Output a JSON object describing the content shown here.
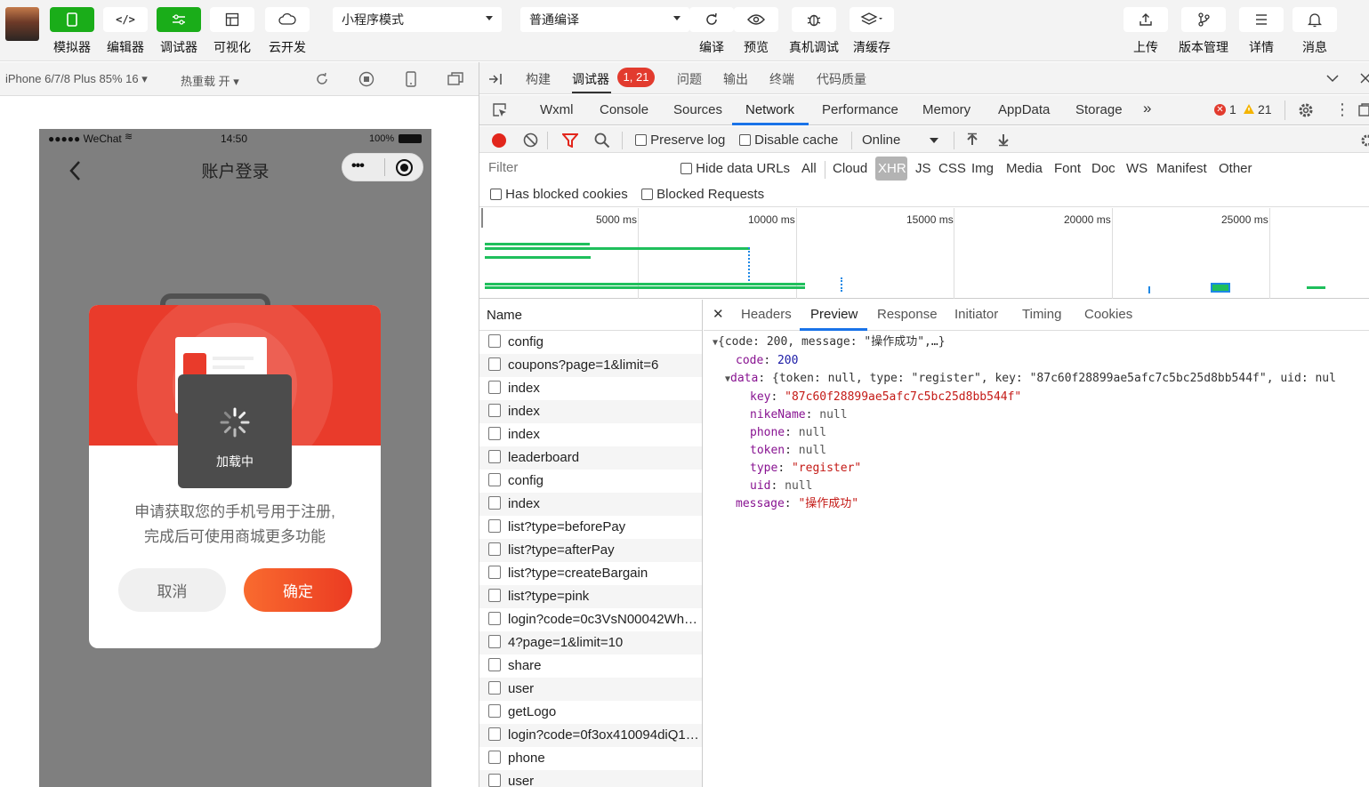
{
  "toolbar": {
    "buttons": [
      {
        "label": "模拟器",
        "icon": "phone-icon"
      },
      {
        "label": "编辑器",
        "icon": "code-icon"
      },
      {
        "label": "调试器",
        "icon": "sliders-icon"
      },
      {
        "label": "可视化",
        "icon": "layout-icon"
      },
      {
        "label": "云开发",
        "icon": "cloud-icon"
      }
    ],
    "mode_select": "小程序模式",
    "compile_select": "普通编译",
    "actions": [
      {
        "label": "编译",
        "icon": "refresh-icon"
      },
      {
        "label": "预览",
        "icon": "eye-icon"
      },
      {
        "label": "真机调试",
        "icon": "bug-icon"
      },
      {
        "label": "清缓存",
        "icon": "layers-icon"
      }
    ],
    "right_actions": [
      {
        "label": "上传",
        "icon": "upload-icon"
      },
      {
        "label": "版本管理",
        "icon": "branch-icon"
      },
      {
        "label": "详情",
        "icon": "menu-icon"
      },
      {
        "label": "消息",
        "icon": "bell-icon"
      }
    ]
  },
  "simulator_bar": {
    "device": "iPhone 6/7/8 Plus 85% 16 ▾",
    "hot_reload": "热重载 开 ▾"
  },
  "phone": {
    "status_left": "●●●●● WeChat",
    "status_time": "14:50",
    "status_battery": "100%",
    "nav_title": "账户登录",
    "dialog_message_line1": "申请获取您的手机号用于注册,",
    "dialog_message_line2": "完成后可使用商城更多功能",
    "cancel_label": "取消",
    "confirm_label": "确定",
    "toast_text": "加载中"
  },
  "devtools": {
    "top_tabs": [
      "构建",
      "调试器",
      "问题",
      "输出",
      "终端",
      "代码质量"
    ],
    "top_badge": "1, 21",
    "panel_tabs": [
      "Wxml",
      "Console",
      "Sources",
      "Network",
      "Performance",
      "Memory",
      "AppData",
      "Storage"
    ],
    "active_panel": "Network",
    "more_tabs": "»",
    "error_count": "1",
    "warning_count": "21",
    "preserve_log": "Preserve log",
    "disable_cache": "Disable cache",
    "throttle": "Online",
    "filter_placeholder": "Filter",
    "hide_data_urls": "Hide data URLs",
    "filter_types": [
      "All",
      "Cloud",
      "XHR",
      "JS",
      "CSS",
      "Img",
      "Media",
      "Font",
      "Doc",
      "WS",
      "Manifest",
      "Other"
    ],
    "active_filter": "XHR",
    "has_blocked_cookies": "Has blocked cookies",
    "blocked_requests": "Blocked Requests",
    "timeline_ticks": [
      "5000 ms",
      "10000 ms",
      "15000 ms",
      "20000 ms",
      "25000 ms"
    ],
    "name_header": "Name",
    "requests": [
      "config",
      "coupons?page=1&limit=6",
      "index",
      "index",
      "index",
      "leaderboard",
      "config",
      "index",
      "list?type=beforePay",
      "list?type=afterPay",
      "list?type=createBargain",
      "list?type=pink",
      "login?code=0c3VsN00042Wh…",
      "4?page=1&limit=10",
      "share",
      "user",
      "getLogo",
      "login?code=0f3ox410094diQ1…",
      "phone",
      "user"
    ],
    "detail_tabs": [
      "Headers",
      "Preview",
      "Response",
      "Initiator",
      "Timing",
      "Cookies"
    ],
    "active_detail_tab": "Preview",
    "close_glyph": "✕",
    "preview": {
      "summary": "{code: 200, message: \"操作成功\",…}",
      "code_key": "code",
      "code_val": "200",
      "data_key": "data",
      "data_summary": "{token: null, type: \"register\", key: \"87c60f28899ae5afc7c5bc25d8bb544f\", uid: nul",
      "key_key": "key",
      "key_val": "\"87c60f28899ae5afc7c5bc25d8bb544f\"",
      "nike_key": "nikeName",
      "nike_val": "null",
      "phone_key": "phone",
      "phone_val": "null",
      "token_key": "token",
      "token_val": "null",
      "type_key": "type",
      "type_val": "\"register\"",
      "uid_key": "uid",
      "uid_val": "null",
      "message_key": "message",
      "message_val": "\"操作成功\""
    }
  }
}
